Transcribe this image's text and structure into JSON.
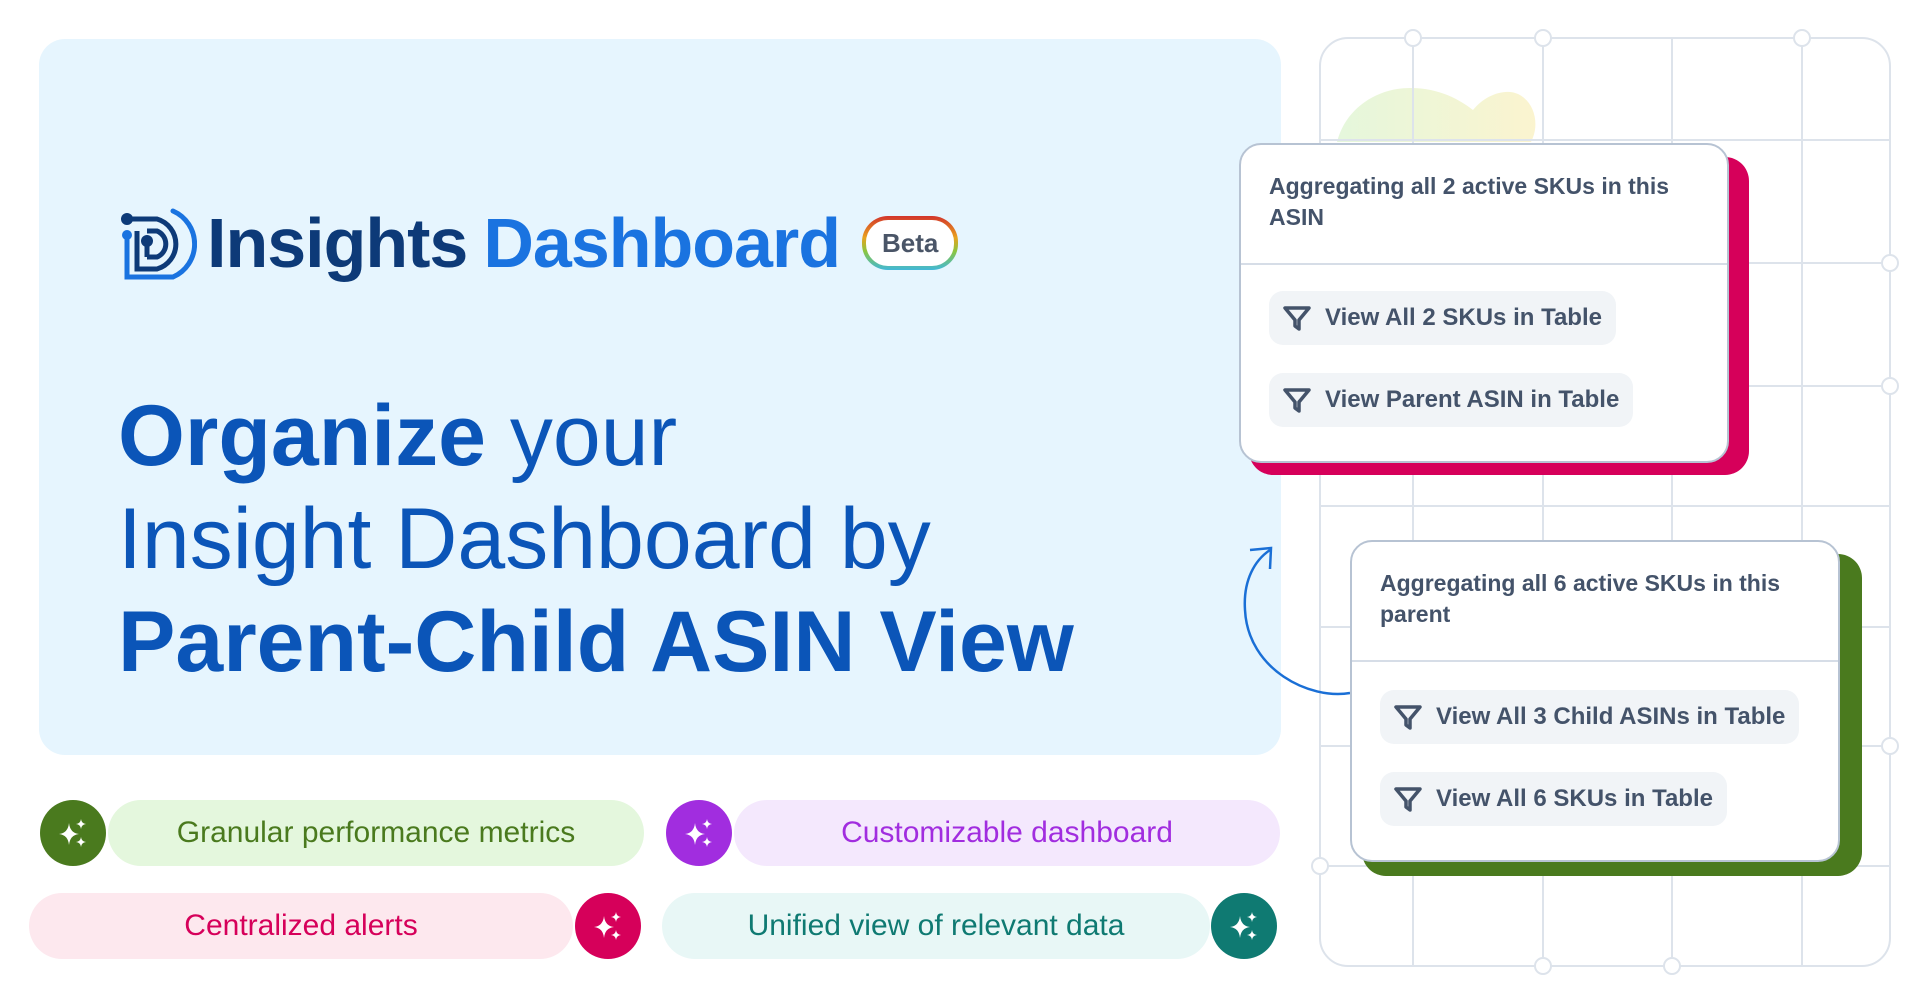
{
  "brand": {
    "name_part1": "Insights",
    "name_part2": "Dashboard",
    "badge": "Beta",
    "logo_icon": "insights-d-logo-icon"
  },
  "headline": {
    "line1_bold": "Organize",
    "line1_light": " your",
    "line2": "Insight Dashboard by",
    "line3": "Parent-Child ASIN View"
  },
  "cards": [
    {
      "title": "Aggregating all 2 active SKUs in this ASIN",
      "accent": "#d6005a",
      "buttons": [
        {
          "label": "View All 2 SKUs in Table",
          "icon": "filter-icon"
        },
        {
          "label": "View Parent ASIN in Table",
          "icon": "filter-icon"
        }
      ]
    },
    {
      "title": "Aggregating all 6 active SKUs in this parent",
      "accent": "#4a7a1e",
      "buttons": [
        {
          "label": "View All 3 Child ASINs in Table",
          "icon": "filter-icon"
        },
        {
          "label": "View All 6 SKUs in Table",
          "icon": "filter-icon"
        }
      ]
    }
  ],
  "features": [
    {
      "label": "Granular performance metrics",
      "icon": "sparkles-icon",
      "color": "#4a7a1e",
      "bg": "#e4f7dd"
    },
    {
      "label": "Customizable dashboard",
      "icon": "sparkles-icon",
      "color": "#a12ddf",
      "bg": "#f4e8fd"
    },
    {
      "label": "Centralized alerts",
      "icon": "sparkles-icon",
      "color": "#d6005a",
      "bg": "#fde8ee"
    },
    {
      "label": "Unified view of relevant data",
      "icon": "sparkles-icon",
      "color": "#0f7a72",
      "bg": "#e8f7f6"
    }
  ],
  "colors": {
    "hero_bg": "#e6f5fe",
    "brand_dark": "#0d3a78",
    "brand_blue": "#1a73e0",
    "headline": "#0b55b8",
    "card_text": "#44536a",
    "grid_line": "#dde3eb"
  }
}
